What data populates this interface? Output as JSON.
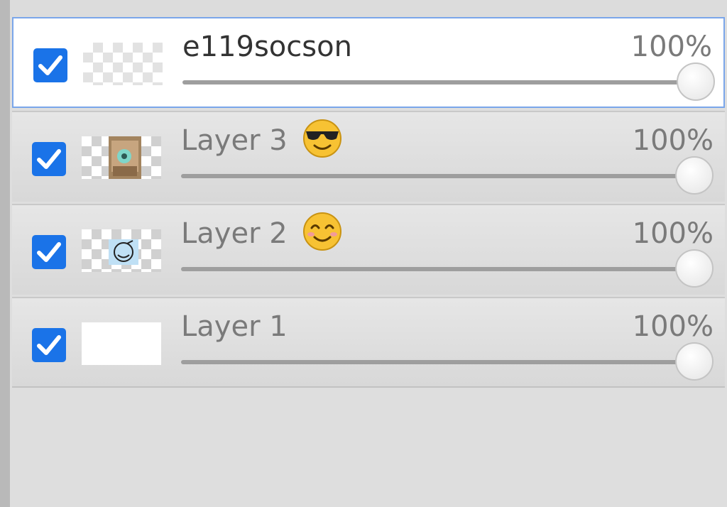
{
  "layers": [
    {
      "name": "e119socson",
      "emoji": "",
      "opacity": "100%",
      "opacity_value": 100,
      "visible": true,
      "selected": true
    },
    {
      "name": "Layer 3",
      "emoji": "smiling-face-with-sunglasses",
      "opacity": "100%",
      "opacity_value": 100,
      "visible": true,
      "selected": false
    },
    {
      "name": "Layer 2",
      "emoji": "smiling-face-with-smiling-eyes",
      "opacity": "100%",
      "opacity_value": 100,
      "visible": true,
      "selected": false
    },
    {
      "name": "Layer 1",
      "emoji": "",
      "opacity": "100%",
      "opacity_value": 100,
      "visible": true,
      "selected": false
    }
  ],
  "colors": {
    "checkbox": "#1a73e8",
    "selection_border": "#7aa6ea",
    "emoji_face": "#f7c233"
  },
  "icons": {
    "checkbox": "checkmark-icon",
    "slider": "slider-handle"
  }
}
